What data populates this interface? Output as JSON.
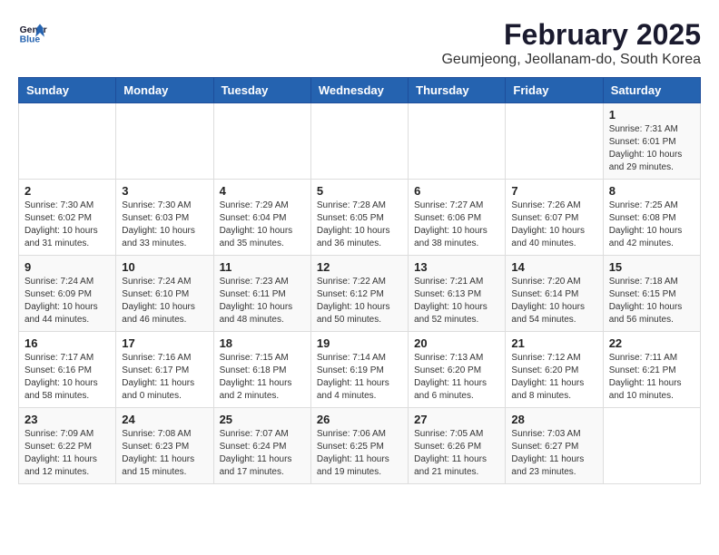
{
  "header": {
    "logo_line1": "General",
    "logo_line2": "Blue",
    "month_title": "February 2025",
    "location": "Geumjeong, Jeollanam-do, South Korea"
  },
  "days_of_week": [
    "Sunday",
    "Monday",
    "Tuesday",
    "Wednesday",
    "Thursday",
    "Friday",
    "Saturday"
  ],
  "weeks": [
    [
      {
        "day": "",
        "info": ""
      },
      {
        "day": "",
        "info": ""
      },
      {
        "day": "",
        "info": ""
      },
      {
        "day": "",
        "info": ""
      },
      {
        "day": "",
        "info": ""
      },
      {
        "day": "",
        "info": ""
      },
      {
        "day": "1",
        "info": "Sunrise: 7:31 AM\nSunset: 6:01 PM\nDaylight: 10 hours and 29 minutes."
      }
    ],
    [
      {
        "day": "2",
        "info": "Sunrise: 7:30 AM\nSunset: 6:02 PM\nDaylight: 10 hours and 31 minutes."
      },
      {
        "day": "3",
        "info": "Sunrise: 7:30 AM\nSunset: 6:03 PM\nDaylight: 10 hours and 33 minutes."
      },
      {
        "day": "4",
        "info": "Sunrise: 7:29 AM\nSunset: 6:04 PM\nDaylight: 10 hours and 35 minutes."
      },
      {
        "day": "5",
        "info": "Sunrise: 7:28 AM\nSunset: 6:05 PM\nDaylight: 10 hours and 36 minutes."
      },
      {
        "day": "6",
        "info": "Sunrise: 7:27 AM\nSunset: 6:06 PM\nDaylight: 10 hours and 38 minutes."
      },
      {
        "day": "7",
        "info": "Sunrise: 7:26 AM\nSunset: 6:07 PM\nDaylight: 10 hours and 40 minutes."
      },
      {
        "day": "8",
        "info": "Sunrise: 7:25 AM\nSunset: 6:08 PM\nDaylight: 10 hours and 42 minutes."
      }
    ],
    [
      {
        "day": "9",
        "info": "Sunrise: 7:24 AM\nSunset: 6:09 PM\nDaylight: 10 hours and 44 minutes."
      },
      {
        "day": "10",
        "info": "Sunrise: 7:24 AM\nSunset: 6:10 PM\nDaylight: 10 hours and 46 minutes."
      },
      {
        "day": "11",
        "info": "Sunrise: 7:23 AM\nSunset: 6:11 PM\nDaylight: 10 hours and 48 minutes."
      },
      {
        "day": "12",
        "info": "Sunrise: 7:22 AM\nSunset: 6:12 PM\nDaylight: 10 hours and 50 minutes."
      },
      {
        "day": "13",
        "info": "Sunrise: 7:21 AM\nSunset: 6:13 PM\nDaylight: 10 hours and 52 minutes."
      },
      {
        "day": "14",
        "info": "Sunrise: 7:20 AM\nSunset: 6:14 PM\nDaylight: 10 hours and 54 minutes."
      },
      {
        "day": "15",
        "info": "Sunrise: 7:18 AM\nSunset: 6:15 PM\nDaylight: 10 hours and 56 minutes."
      }
    ],
    [
      {
        "day": "16",
        "info": "Sunrise: 7:17 AM\nSunset: 6:16 PM\nDaylight: 10 hours and 58 minutes."
      },
      {
        "day": "17",
        "info": "Sunrise: 7:16 AM\nSunset: 6:17 PM\nDaylight: 11 hours and 0 minutes."
      },
      {
        "day": "18",
        "info": "Sunrise: 7:15 AM\nSunset: 6:18 PM\nDaylight: 11 hours and 2 minutes."
      },
      {
        "day": "19",
        "info": "Sunrise: 7:14 AM\nSunset: 6:19 PM\nDaylight: 11 hours and 4 minutes."
      },
      {
        "day": "20",
        "info": "Sunrise: 7:13 AM\nSunset: 6:20 PM\nDaylight: 11 hours and 6 minutes."
      },
      {
        "day": "21",
        "info": "Sunrise: 7:12 AM\nSunset: 6:20 PM\nDaylight: 11 hours and 8 minutes."
      },
      {
        "day": "22",
        "info": "Sunrise: 7:11 AM\nSunset: 6:21 PM\nDaylight: 11 hours and 10 minutes."
      }
    ],
    [
      {
        "day": "23",
        "info": "Sunrise: 7:09 AM\nSunset: 6:22 PM\nDaylight: 11 hours and 12 minutes."
      },
      {
        "day": "24",
        "info": "Sunrise: 7:08 AM\nSunset: 6:23 PM\nDaylight: 11 hours and 15 minutes."
      },
      {
        "day": "25",
        "info": "Sunrise: 7:07 AM\nSunset: 6:24 PM\nDaylight: 11 hours and 17 minutes."
      },
      {
        "day": "26",
        "info": "Sunrise: 7:06 AM\nSunset: 6:25 PM\nDaylight: 11 hours and 19 minutes."
      },
      {
        "day": "27",
        "info": "Sunrise: 7:05 AM\nSunset: 6:26 PM\nDaylight: 11 hours and 21 minutes."
      },
      {
        "day": "28",
        "info": "Sunrise: 7:03 AM\nSunset: 6:27 PM\nDaylight: 11 hours and 23 minutes."
      },
      {
        "day": "",
        "info": ""
      }
    ]
  ]
}
